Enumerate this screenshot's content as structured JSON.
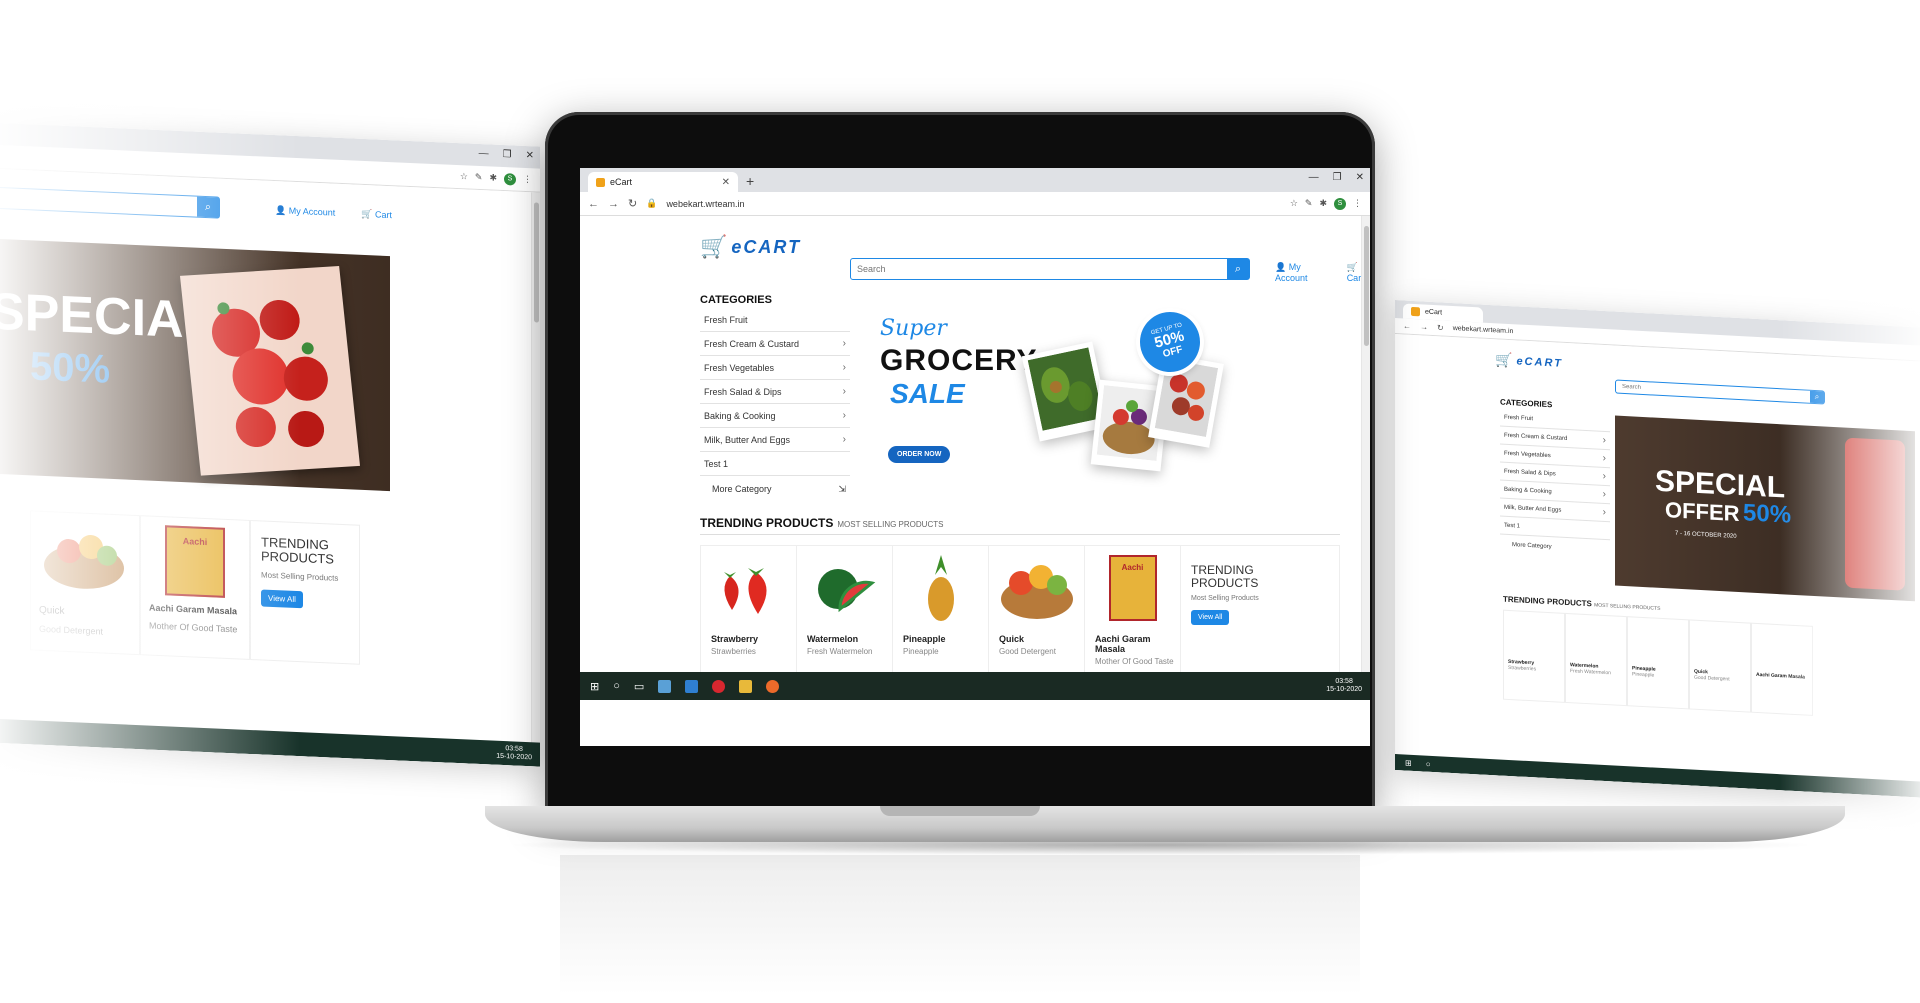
{
  "browser": {
    "tab_title": "eCart",
    "url": "webekart.wrteam.in",
    "avatar_initial": "S"
  },
  "site": {
    "logo_text": "eCART",
    "search_placeholder": "Search",
    "my_account": "My Account",
    "cart": "Cart"
  },
  "categories": {
    "title": "CATEGORIES",
    "items": [
      {
        "label": "Fresh Fruit"
      },
      {
        "label": "Fresh Cream & Custard"
      },
      {
        "label": "Fresh Vegetables"
      },
      {
        "label": "Fresh Salad & Dips"
      },
      {
        "label": "Baking & Cooking"
      },
      {
        "label": "Milk, Butter And Eggs"
      },
      {
        "label": "Test 1"
      }
    ],
    "more": "More Category"
  },
  "banner": {
    "super": "Super",
    "grocery": "GROCERY",
    "sale": "SALE",
    "cta": "ORDER NOW",
    "badge_top": "GET UP TO",
    "badge_pct": "50%",
    "badge_off": "OFF"
  },
  "banner_alt": {
    "line1": "SPECIAL",
    "line2": "OFFER",
    "pct": "50%",
    "off": "OFF",
    "date": "7 - 16 OCTOBER 2020"
  },
  "trending": {
    "title": "TRENDING PRODUCTS",
    "subtitle": "MOST SELLING PRODUCTS",
    "products": [
      {
        "name": "Strawberry",
        "sub": "Strawberries"
      },
      {
        "name": "Watermelon",
        "sub": "Fresh Watermelon"
      },
      {
        "name": "Pineapple",
        "sub": "Pineapple"
      },
      {
        "name": "Quick",
        "sub": "Good Detergent"
      },
      {
        "name": "Aachi Garam Masala",
        "sub": "Mother Of Good Taste"
      }
    ],
    "card_title": "TRENDING PRODUCTS",
    "card_sub": "Most Selling Products",
    "view_all": "View All"
  },
  "taskbar": {
    "time": "03:58",
    "date": "15-10-2020"
  }
}
